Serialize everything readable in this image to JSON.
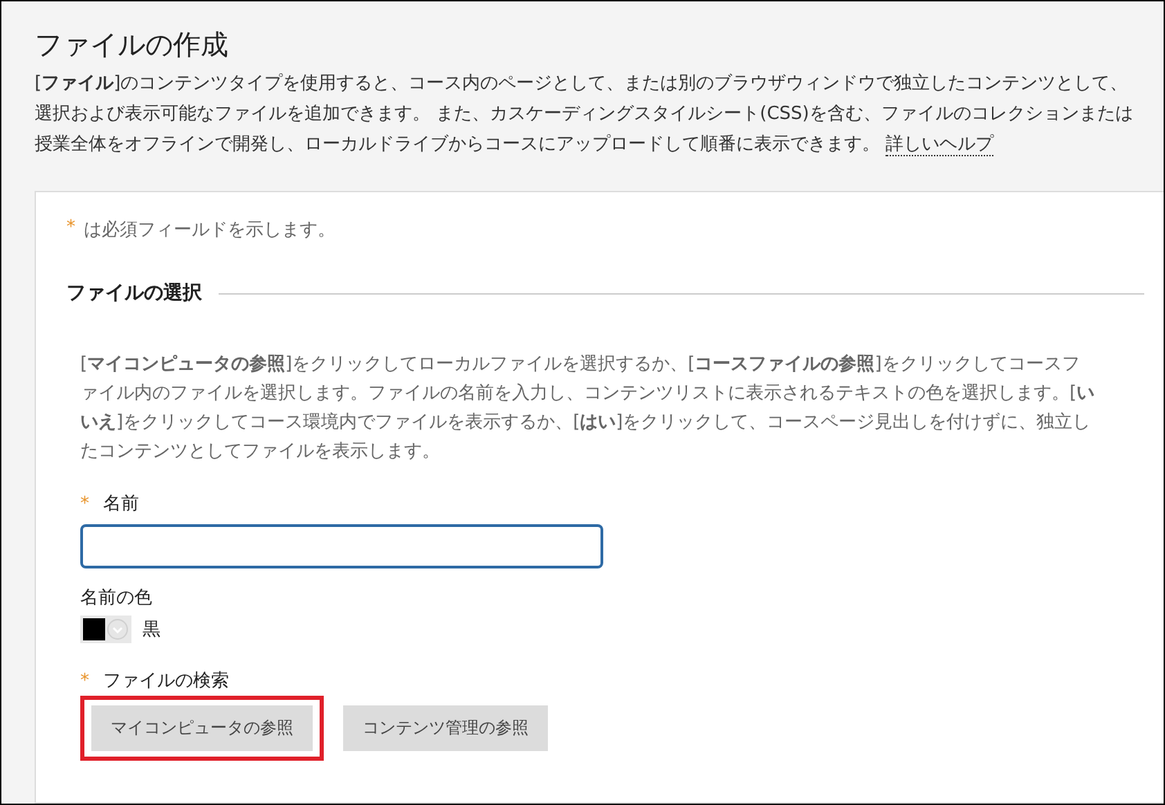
{
  "page": {
    "title": "ファイルの作成",
    "description": "[**ファイル**]のコンテンツタイプを使用すると、コース内のページとして、または別のブラウザウィンドウで独立したコンテンツとして、選択および表示可能なファイルを追加できます。 また、カスケーディングスタイルシート(CSS)を含む、ファイルのコレクションまたは授業全体をオフラインで開発し、ローカルドライブからコースにアップロードして順番に表示できます。",
    "help_link": "詳しいヘルプ"
  },
  "form": {
    "required_note": {
      "mark": "*",
      "text": "は必須フィールドを示します。"
    },
    "section": {
      "title": "ファイルの選択",
      "instructions": "[**マイコンピュータの参照**]をクリックしてローカルファイルを選択するか、[**コースファイルの参照**]をクリックしてコースファイル内のファイルを選択します。ファイルの名前を入力し、コンテンツリストに表示されるテキストの色を選択します。[**いいえ**]をクリックしてコース環境内でファイルを表示するか、[**はい**]をクリックして、コースページ見出しを付けずに、独立したコンテンツとしてファイルを表示します。"
    },
    "name_field": {
      "label": "名前",
      "required": true
    },
    "color_field": {
      "label": "名前の色",
      "color": "#000000",
      "value": "黒"
    },
    "file_field": {
      "label": "ファイルの検索",
      "required": true,
      "buttons": [
        {
          "label": "マイコンピュータの参照",
          "highlighted": true
        },
        {
          "label": "コンテンツ管理の参照",
          "highlighted": false
        }
      ]
    }
  }
}
